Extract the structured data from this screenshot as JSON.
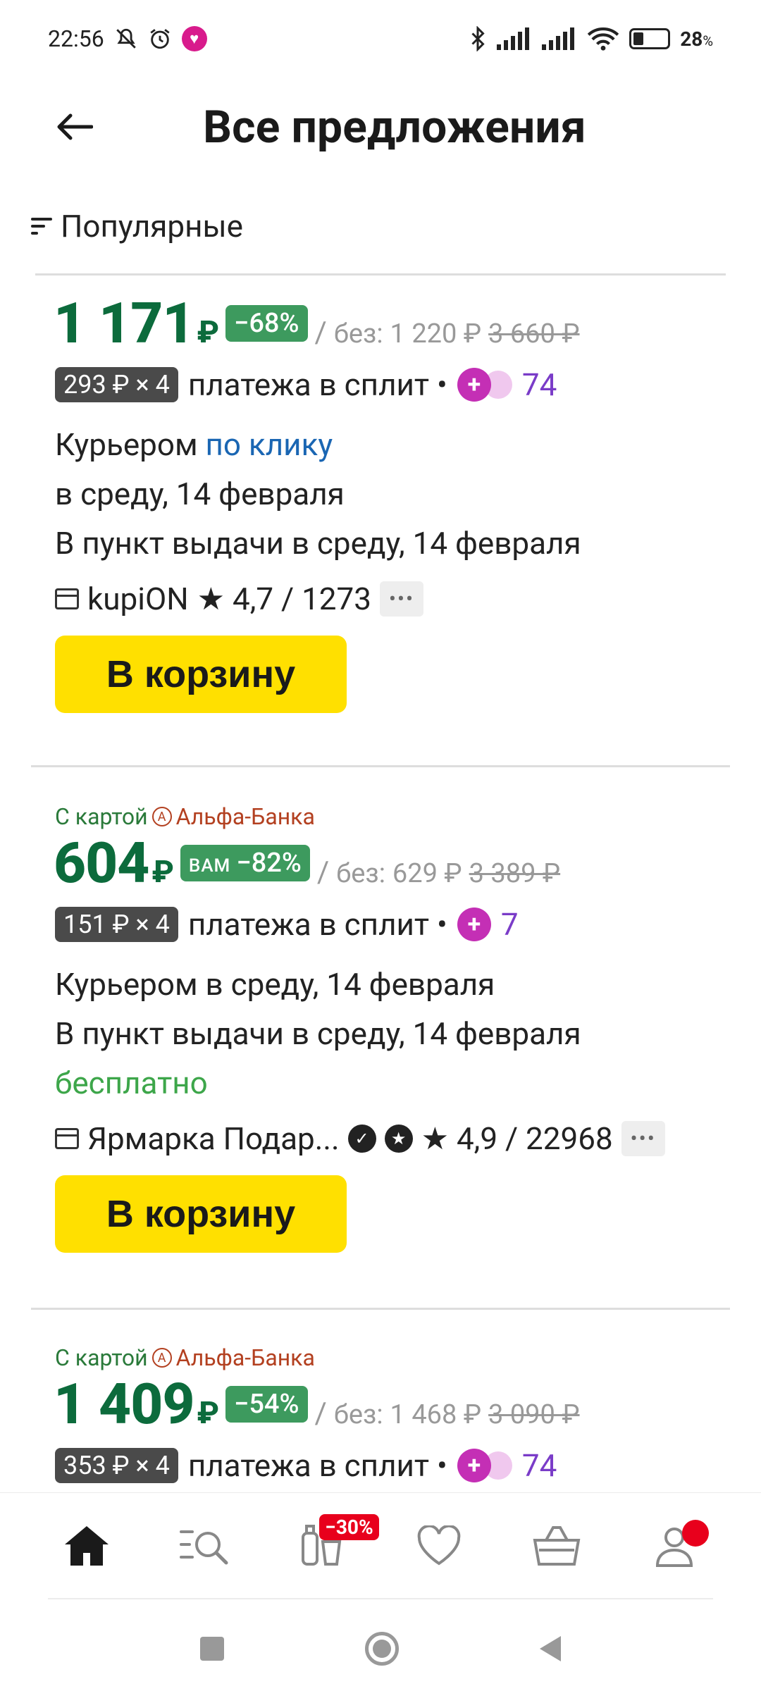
{
  "status": {
    "time": "22:56",
    "battery": "28",
    "battery_unit": "%"
  },
  "header": {
    "title": "Все предложения"
  },
  "sort": {
    "label": "Популярные"
  },
  "offers": [
    {
      "price": "1 171",
      "currency": "₽",
      "discount": "−68%",
      "without_label": "без:",
      "price_without": "1 220 ₽",
      "old_price": "3 660 ₽",
      "split_amount": "293 ₽ × 4",
      "split_text": "платежа в сплит •",
      "plus_points": "74",
      "delivery_courier_prefix": "Курьером",
      "delivery_courier_link": "по клику",
      "delivery_line2": "в среду, 14 февраля",
      "delivery_pickup": "В пункт выдачи в среду, 14 февраля",
      "seller": "kupiON",
      "rating": "★ 4,7 / 1273",
      "cart_label": "В корзину"
    },
    {
      "bank_prefix": "С картой",
      "bank_name": "Альфа-Банка",
      "price": "604",
      "currency": "₽",
      "discount_prefix": "ВАМ",
      "discount": "−82%",
      "without_label": "без:",
      "price_without": "629 ₽",
      "old_price": "3 389 ₽",
      "split_amount": "151 ₽ × 4",
      "split_text": "платежа в сплит •",
      "plus_points": "7",
      "delivery_courier": "Курьером в среду, 14 февраля",
      "delivery_pickup": "В пункт выдачи в среду, 14 февраля",
      "delivery_free": "бесплатно",
      "seller": "Ярмарка Подар...",
      "rating": "★ 4,9 / 22968",
      "cart_label": "В корзину"
    },
    {
      "bank_prefix": "С картой",
      "bank_name": "Альфа-Банка",
      "price": "1 409",
      "currency": "₽",
      "discount": "−54%",
      "without_label": "без:",
      "price_without": "1 468 ₽",
      "old_price": "3 090 ₽",
      "split_amount": "353 ₽ × 4",
      "split_text": "платежа в сплит •",
      "plus_points": "74"
    }
  ],
  "bottom_nav": {
    "promo_badge": "−30%"
  },
  "colors": {
    "price_green": "#0c6b3c",
    "badge_green": "#3d9a5e",
    "cart_yellow": "#ffe000",
    "plus_purple": "#7a3cc8",
    "link_blue": "#1a66b3"
  }
}
